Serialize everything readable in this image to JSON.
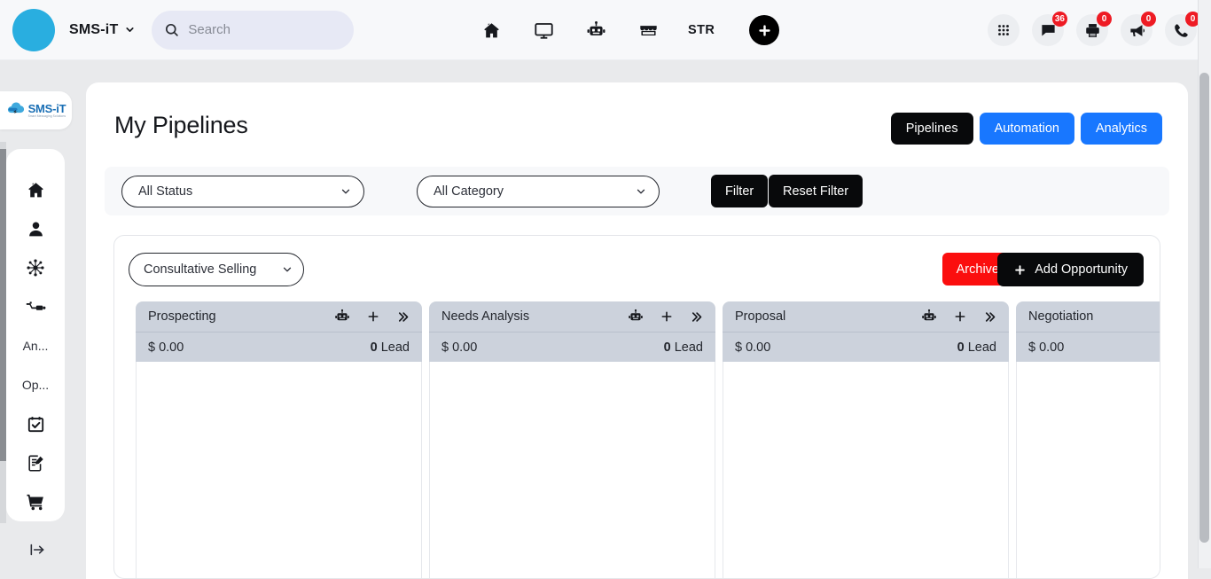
{
  "topbar": {
    "brand_name": "SMS-iT",
    "brand_caret_icon": "chevron-down-icon",
    "search": {
      "placeholder": "Search",
      "value": "",
      "icon": "search-icon"
    },
    "center_nav": [
      {
        "icon": "home-icon",
        "label": ""
      },
      {
        "icon": "monitor-icon",
        "label": ""
      },
      {
        "icon": "robot-icon",
        "label": ""
      },
      {
        "icon": "store-icon",
        "label": ""
      },
      {
        "icon": "str-text",
        "label": "STR"
      }
    ],
    "add_button": {
      "icon": "plus-icon",
      "label": ""
    },
    "right_nav": [
      {
        "icon": "apps-grid-icon",
        "badge": ""
      },
      {
        "icon": "chat-icon",
        "badge": "36"
      },
      {
        "icon": "printer-icon",
        "badge": "0"
      },
      {
        "icon": "megaphone-icon",
        "badge": "0"
      },
      {
        "icon": "phone-icon",
        "badge": "0"
      }
    ]
  },
  "sidebar": {
    "logo": {
      "main": "SMS-iT",
      "sub": "Smart Messaging Solutions",
      "icon": "cloud-logo-icon"
    },
    "items": [
      {
        "type": "icon",
        "icon": "home-icon",
        "label": ""
      },
      {
        "type": "icon",
        "icon": "contact-person-icon",
        "label": ""
      },
      {
        "type": "icon",
        "icon": "network-hub-icon",
        "label": ""
      },
      {
        "type": "icon",
        "icon": "funnel-pipeline-icon",
        "label": ""
      },
      {
        "type": "text",
        "icon": "",
        "label": "An..."
      },
      {
        "type": "text",
        "icon": "",
        "label": "Op..."
      },
      {
        "type": "icon",
        "icon": "calendar-check-icon",
        "label": ""
      },
      {
        "type": "icon",
        "icon": "document-edit-icon",
        "label": ""
      },
      {
        "type": "icon",
        "icon": "shopping-cart-icon",
        "label": ""
      },
      {
        "type": "icon",
        "icon": "id-badge-icon",
        "label": ""
      }
    ],
    "expand": {
      "icon": "expand-arrow-icon",
      "label": ""
    }
  },
  "page": {
    "title": "My Pipelines",
    "tabs": [
      {
        "label": "Pipelines",
        "active": true
      },
      {
        "label": "Automation",
        "active": false
      },
      {
        "label": "Analytics",
        "active": false
      }
    ]
  },
  "filters": {
    "status": {
      "value": "All Status",
      "caret_icon": "chevron-down-icon"
    },
    "category": {
      "value": "All Category",
      "caret_icon": "chevron-down-icon"
    },
    "filter_button": "Filter",
    "reset_button": "Reset Filter"
  },
  "pipeline": {
    "selected": "Consultative Selling",
    "selector_caret_icon": "chevron-down-icon",
    "archive_button": "Archive",
    "add_opportunity_button": "Add Opportunity",
    "add_opportunity_icon": "plus-icon",
    "columns": [
      {
        "title": "Prospecting",
        "amount": "$ 0.00",
        "count": "0",
        "count_label": "Lead",
        "show_actions": true
      },
      {
        "title": "Needs Analysis",
        "amount": "$ 0.00",
        "count": "0",
        "count_label": "Lead",
        "show_actions": true
      },
      {
        "title": "Proposal",
        "amount": "$ 0.00",
        "count": "0",
        "count_label": "Lead",
        "show_actions": true
      },
      {
        "title": "Negotiation",
        "amount": "$ 0.00",
        "count": "",
        "count_label": "",
        "show_actions": false
      }
    ],
    "column_action_icons": [
      "robot-icon",
      "plus-icon",
      "double-chevron-right-icon"
    ]
  },
  "colors": {
    "accent_blue": "#1877ff",
    "dark": "#08090b",
    "danger_red": "#fb0e0e",
    "badge_red": "#ee1b24",
    "brand_cyan": "#29aee0",
    "column_header": "#ccd2dc"
  }
}
